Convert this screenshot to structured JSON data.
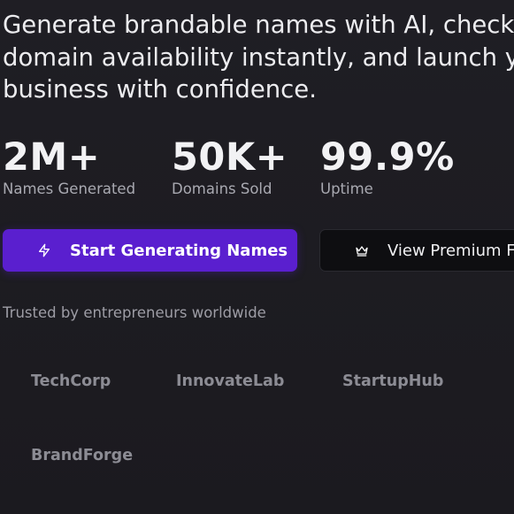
{
  "hero": {
    "headline_lines": [
      "Generate brandable names with AI, check",
      "domain availability instantly, and launch your",
      "business with confidence."
    ]
  },
  "stats": [
    {
      "value": "2M+",
      "label": "Names Generated"
    },
    {
      "value": "50K+",
      "label": "Domains Sold"
    },
    {
      "value": "99.9%",
      "label": "Uptime"
    }
  ],
  "actions": {
    "primary_label": "Start Generating Names",
    "primary_icon": "lightning-icon",
    "secondary_label": "View Premium Features",
    "secondary_icon": "crown-icon"
  },
  "trusted": {
    "text": "Trusted by entrepreneurs worldwide",
    "logos": [
      "TechCorp",
      "InnovateLab",
      "StartupHub",
      "BrandForge"
    ]
  },
  "colors": {
    "background": "#1d1c21",
    "primary_button": "#5a1fcf",
    "secondary_button": "#0e0e11"
  }
}
